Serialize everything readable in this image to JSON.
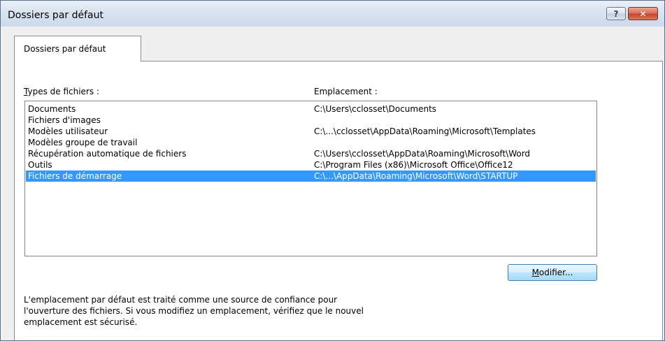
{
  "window": {
    "title": "Dossiers par défaut"
  },
  "titlebar": {
    "help_glyph": "?",
    "close_glyph": "✕"
  },
  "tab": {
    "label": "Dossiers par défaut"
  },
  "columns": {
    "type_header_first": "T",
    "type_header_rest": "ypes de fichiers :",
    "location_header": "Emplacement :"
  },
  "rows": [
    {
      "type": "Documents",
      "location": "C:\\Users\\cclosset\\Documents",
      "selected": false
    },
    {
      "type": "Fichiers d'images",
      "location": "",
      "selected": false
    },
    {
      "type": "Modèles utilisateur",
      "location": "C:\\...\\cclosset\\AppData\\Roaming\\Microsoft\\Templates",
      "selected": false
    },
    {
      "type": "Modèles groupe de travail",
      "location": "",
      "selected": false
    },
    {
      "type": "Récupération automatique de fichiers",
      "location": "C:\\Users\\cclosset\\AppData\\Roaming\\Microsoft\\Word",
      "selected": false
    },
    {
      "type": "Outils",
      "location": "C:\\Program Files (x86)\\Microsoft Office\\Office12",
      "selected": false
    },
    {
      "type": "Fichiers de démarrage",
      "location": "C:\\...\\AppData\\Roaming\\Microsoft\\Word\\STARTUP",
      "selected": true
    }
  ],
  "modify_button": {
    "first": "M",
    "rest": "odifier..."
  },
  "info_lines": [
    "L'emplacement par défaut est traité comme une source de confiance pour",
    "l'ouverture des fichiers. Si vous modifiez un emplacement, vérifiez que le nouvel",
    "emplacement est sécurisé."
  ],
  "colors": {
    "selection": "#3399ff",
    "border": "#898c95"
  }
}
